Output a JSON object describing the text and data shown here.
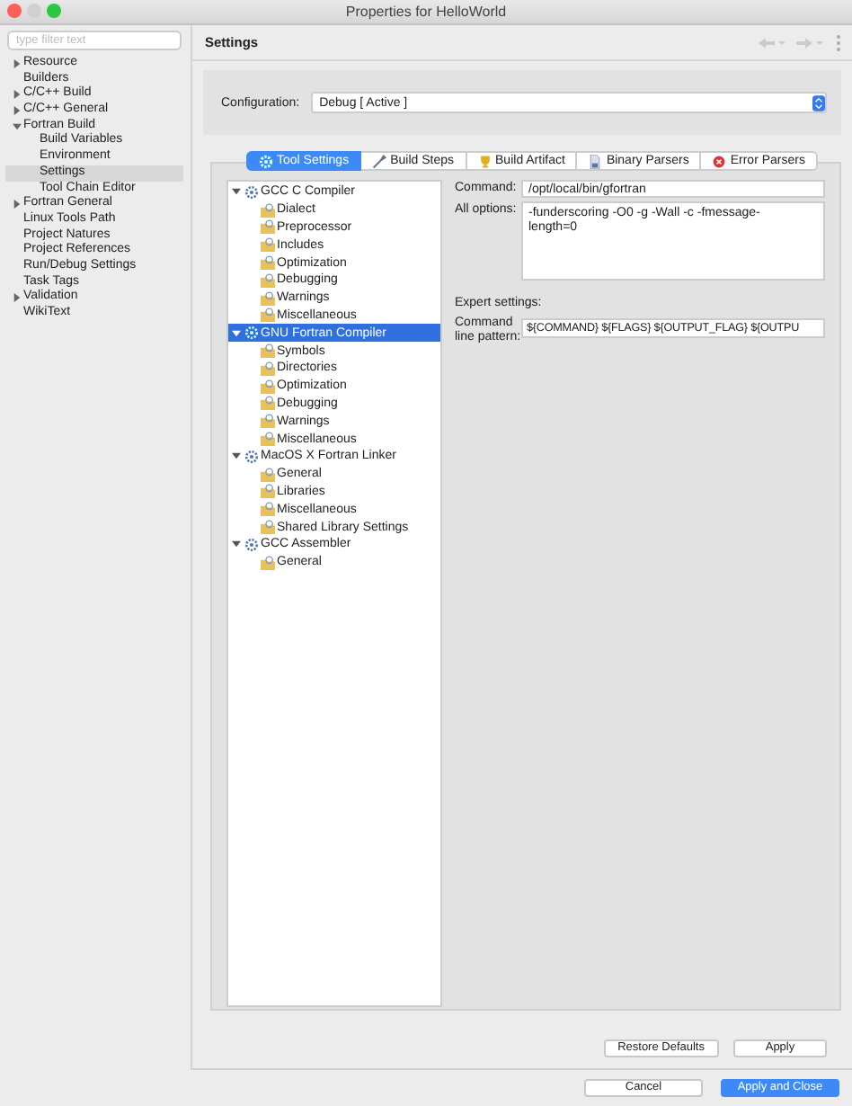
{
  "window": {
    "title": "Properties for HelloWorld"
  },
  "sidebar": {
    "filter": {
      "placeholder": "type filter text"
    },
    "items": [
      {
        "label": "Resource",
        "expanded": false,
        "selected": false
      },
      {
        "label": "Builders",
        "selected": false
      },
      {
        "label": "C/C++ Build",
        "expanded": false,
        "selected": false
      },
      {
        "label": "C/C++ General",
        "expanded": false,
        "selected": false
      },
      {
        "label": "Fortran Build",
        "expanded": true,
        "selected": false,
        "children": [
          {
            "label": "Build Variables",
            "selected": false
          },
          {
            "label": "Environment",
            "selected": false
          },
          {
            "label": "Settings",
            "selected": true
          },
          {
            "label": "Tool Chain Editor",
            "selected": false
          }
        ]
      },
      {
        "label": "Fortran General",
        "expanded": false,
        "selected": false
      },
      {
        "label": "Linux Tools Path",
        "selected": false
      },
      {
        "label": "Project Natures",
        "selected": false
      },
      {
        "label": "Project References",
        "selected": false
      },
      {
        "label": "Run/Debug Settings",
        "selected": false
      },
      {
        "label": "Task Tags",
        "selected": false
      },
      {
        "label": "Validation",
        "expanded": false,
        "selected": false
      },
      {
        "label": "WikiText",
        "selected": false
      }
    ]
  },
  "page_title": "Settings",
  "configuration": {
    "label": "Configuration:",
    "value": "Debug  [ Active ]"
  },
  "tabs": [
    {
      "label": "Tool Settings",
      "selected": true
    },
    {
      "label": "Build Steps",
      "selected": false
    },
    {
      "label": "Build Artifact",
      "selected": false
    },
    {
      "label": "Binary Parsers",
      "selected": false
    },
    {
      "label": "Error Parsers",
      "selected": false
    }
  ],
  "tool_tree": [
    {
      "label": "GCC C Compiler",
      "expanded": true,
      "selected": false,
      "children": [
        {
          "label": "Dialect",
          "selected": false
        },
        {
          "label": "Preprocessor",
          "selected": false
        },
        {
          "label": "Includes",
          "selected": false
        },
        {
          "label": "Optimization",
          "selected": false
        },
        {
          "label": "Debugging",
          "selected": false
        },
        {
          "label": "Warnings",
          "selected": false
        },
        {
          "label": "Miscellaneous",
          "selected": false
        }
      ]
    },
    {
      "label": "GNU Fortran Compiler",
      "expanded": true,
      "selected": true,
      "children": [
        {
          "label": "Symbols",
          "selected": false
        },
        {
          "label": "Directories",
          "selected": false
        },
        {
          "label": "Optimization",
          "selected": false
        },
        {
          "label": "Debugging",
          "selected": false
        },
        {
          "label": "Warnings",
          "selected": false
        },
        {
          "label": "Miscellaneous",
          "selected": false
        }
      ]
    },
    {
      "label": "MacOS X Fortran Linker",
      "expanded": true,
      "selected": false,
      "children": [
        {
          "label": "General",
          "selected": false
        },
        {
          "label": "Libraries",
          "selected": false
        },
        {
          "label": "Miscellaneous",
          "selected": false
        },
        {
          "label": "Shared Library Settings",
          "selected": false
        }
      ]
    },
    {
      "label": "GCC Assembler",
      "expanded": true,
      "selected": false,
      "children": [
        {
          "label": "General",
          "selected": false
        }
      ]
    }
  ],
  "options": {
    "command_label": "Command:",
    "command": "/opt/local/bin/gfortran",
    "all_options_label": "All options:",
    "all_options": "-funderscoring -O0 -g -Wall -c -fmessage-length=0",
    "expert_label": "Expert settings:",
    "pattern_label": "Command line pattern:",
    "pattern": "${COMMAND} ${FLAGS} ${OUTPUT_FLAG} ${OUTPU"
  },
  "page_buttons": [
    "Restore Defaults",
    "Apply"
  ],
  "dialog_buttons": [
    {
      "label": "Cancel",
      "default": false
    },
    {
      "label": "Apply and Close",
      "default": true
    }
  ]
}
